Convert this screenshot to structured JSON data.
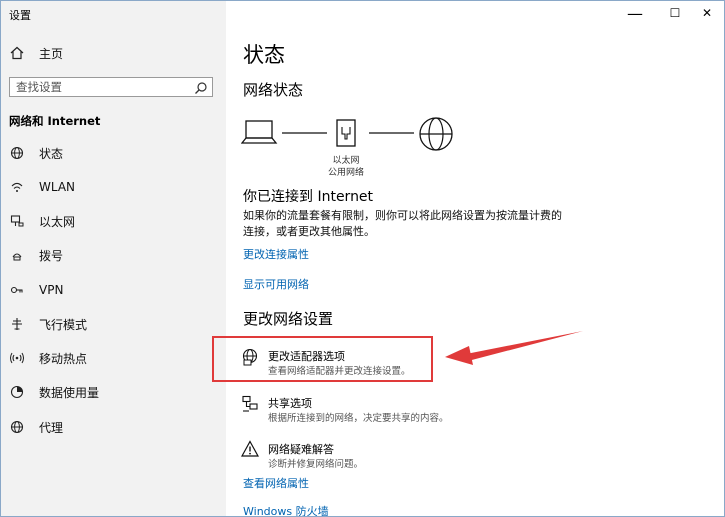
{
  "window": {
    "title": "设置",
    "minimize_glyph": "—",
    "maximize_glyph": "☐",
    "close_glyph": "✕"
  },
  "sidebar": {
    "home_label": "主页",
    "search_placeholder": "查找设置",
    "section_title": "网络和 Internet",
    "items": [
      {
        "label": "状态",
        "icon": "globe-icon"
      },
      {
        "label": "WLAN",
        "icon": "wifi-icon"
      },
      {
        "label": "以太网",
        "icon": "ethernet-icon"
      },
      {
        "label": "拨号",
        "icon": "dialup-icon"
      },
      {
        "label": "VPN",
        "icon": "vpn-icon"
      },
      {
        "label": "飞行模式",
        "icon": "airplane-icon"
      },
      {
        "label": "移动热点",
        "icon": "hotspot-icon"
      },
      {
        "label": "数据使用量",
        "icon": "data-usage-icon"
      },
      {
        "label": "代理",
        "icon": "proxy-icon"
      }
    ]
  },
  "main": {
    "page_title": "状态",
    "network_status_heading": "网络状态",
    "adapter_caption_line1": "以太网",
    "adapter_caption_line2": "公用网络",
    "connected_heading": "你已连接到 Internet",
    "connected_desc": "如果你的流量套餐有限制，则你可以将此网络设置为按流量计费的连接，或者更改其他属性。",
    "link_change_properties": "更改连接属性",
    "link_show_networks": "显示可用网络",
    "change_settings_heading": "更改网络设置",
    "options": [
      {
        "title": "更改适配器选项",
        "desc": "查看网络适配器并更改连接设置。",
        "icon": "adapter-globe-icon"
      },
      {
        "title": "共享选项",
        "desc": "根据所连接到的网络，决定要共享的内容。",
        "icon": "sharing-icon"
      },
      {
        "title": "网络疑难解答",
        "desc": "诊断并修复网络问题。",
        "icon": "warning-icon"
      }
    ],
    "link_view_properties": "查看网络属性",
    "link_firewall": "Windows 防火墙"
  },
  "annotation": {
    "highlight_color": "#e03a3a"
  },
  "colors": {
    "link": "#0063b1",
    "sidebar_bg": "#f2f2f2"
  }
}
